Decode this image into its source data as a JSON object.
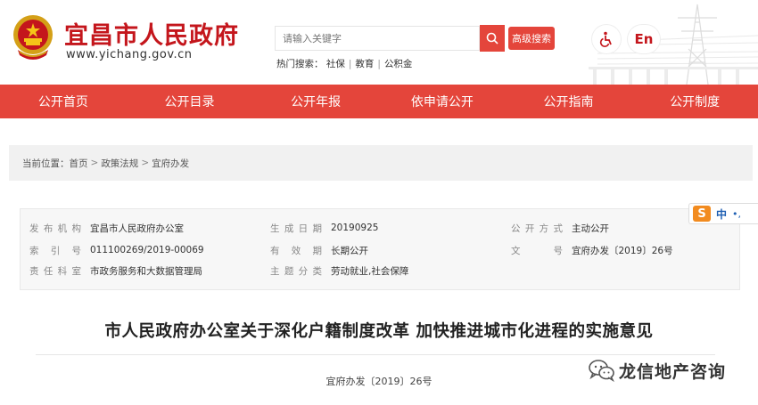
{
  "header": {
    "site_title": "宜昌市人民政府",
    "site_url": "www.yichang.gov.cn",
    "search_placeholder": "请输入关键字",
    "advanced_search_label": "高级搜索",
    "hot_search_label": "热门搜索：",
    "hot_search_items": [
      "社保",
      "教育",
      "公积金"
    ],
    "language_label": "En",
    "accent_color": "#e4453b"
  },
  "nav": {
    "items": [
      "公开首页",
      "公开目录",
      "公开年报",
      "依申请公开",
      "公开指南",
      "公开制度"
    ]
  },
  "breadcrumb": {
    "prefix": "当前位置：",
    "items": [
      "首页",
      "政策法规",
      "宜府办发"
    ],
    "separator": ">"
  },
  "meta": {
    "publisher_label": "发布机构",
    "publisher_value": "宜昌市人民政府办公室",
    "date_label": "生成日期",
    "date_value": "20190925",
    "disclosure_label": "公开方式",
    "disclosure_value": "主动公开",
    "index_label": "索 引 号",
    "index_value": "011100269/2019-00069",
    "validity_label": "有 效 期",
    "validity_value": "长期公开",
    "doc_label": "文　　号",
    "doc_value": "宜府办发〔2019〕26号",
    "dept_label": "责任科室",
    "dept_value": "市政务服务和大数据管理局",
    "topic_label": "主题分类",
    "topic_value": "劳动就业,社会保障"
  },
  "side_widget": {
    "logo_letter": "S",
    "text": "中",
    "dots": "•,"
  },
  "document": {
    "title": "市人民政府办公室关于深化户籍制度改革 加快推进城市化进程的实施意见",
    "number": "宜府办发〔2019〕26号"
  },
  "watermark": {
    "text": "龙信地产咨询"
  },
  "icons": {
    "emblem": "national-emblem-icon",
    "search": "search-icon",
    "accessibility": "wheelchair-icon",
    "wechat": "wechat-icon"
  }
}
